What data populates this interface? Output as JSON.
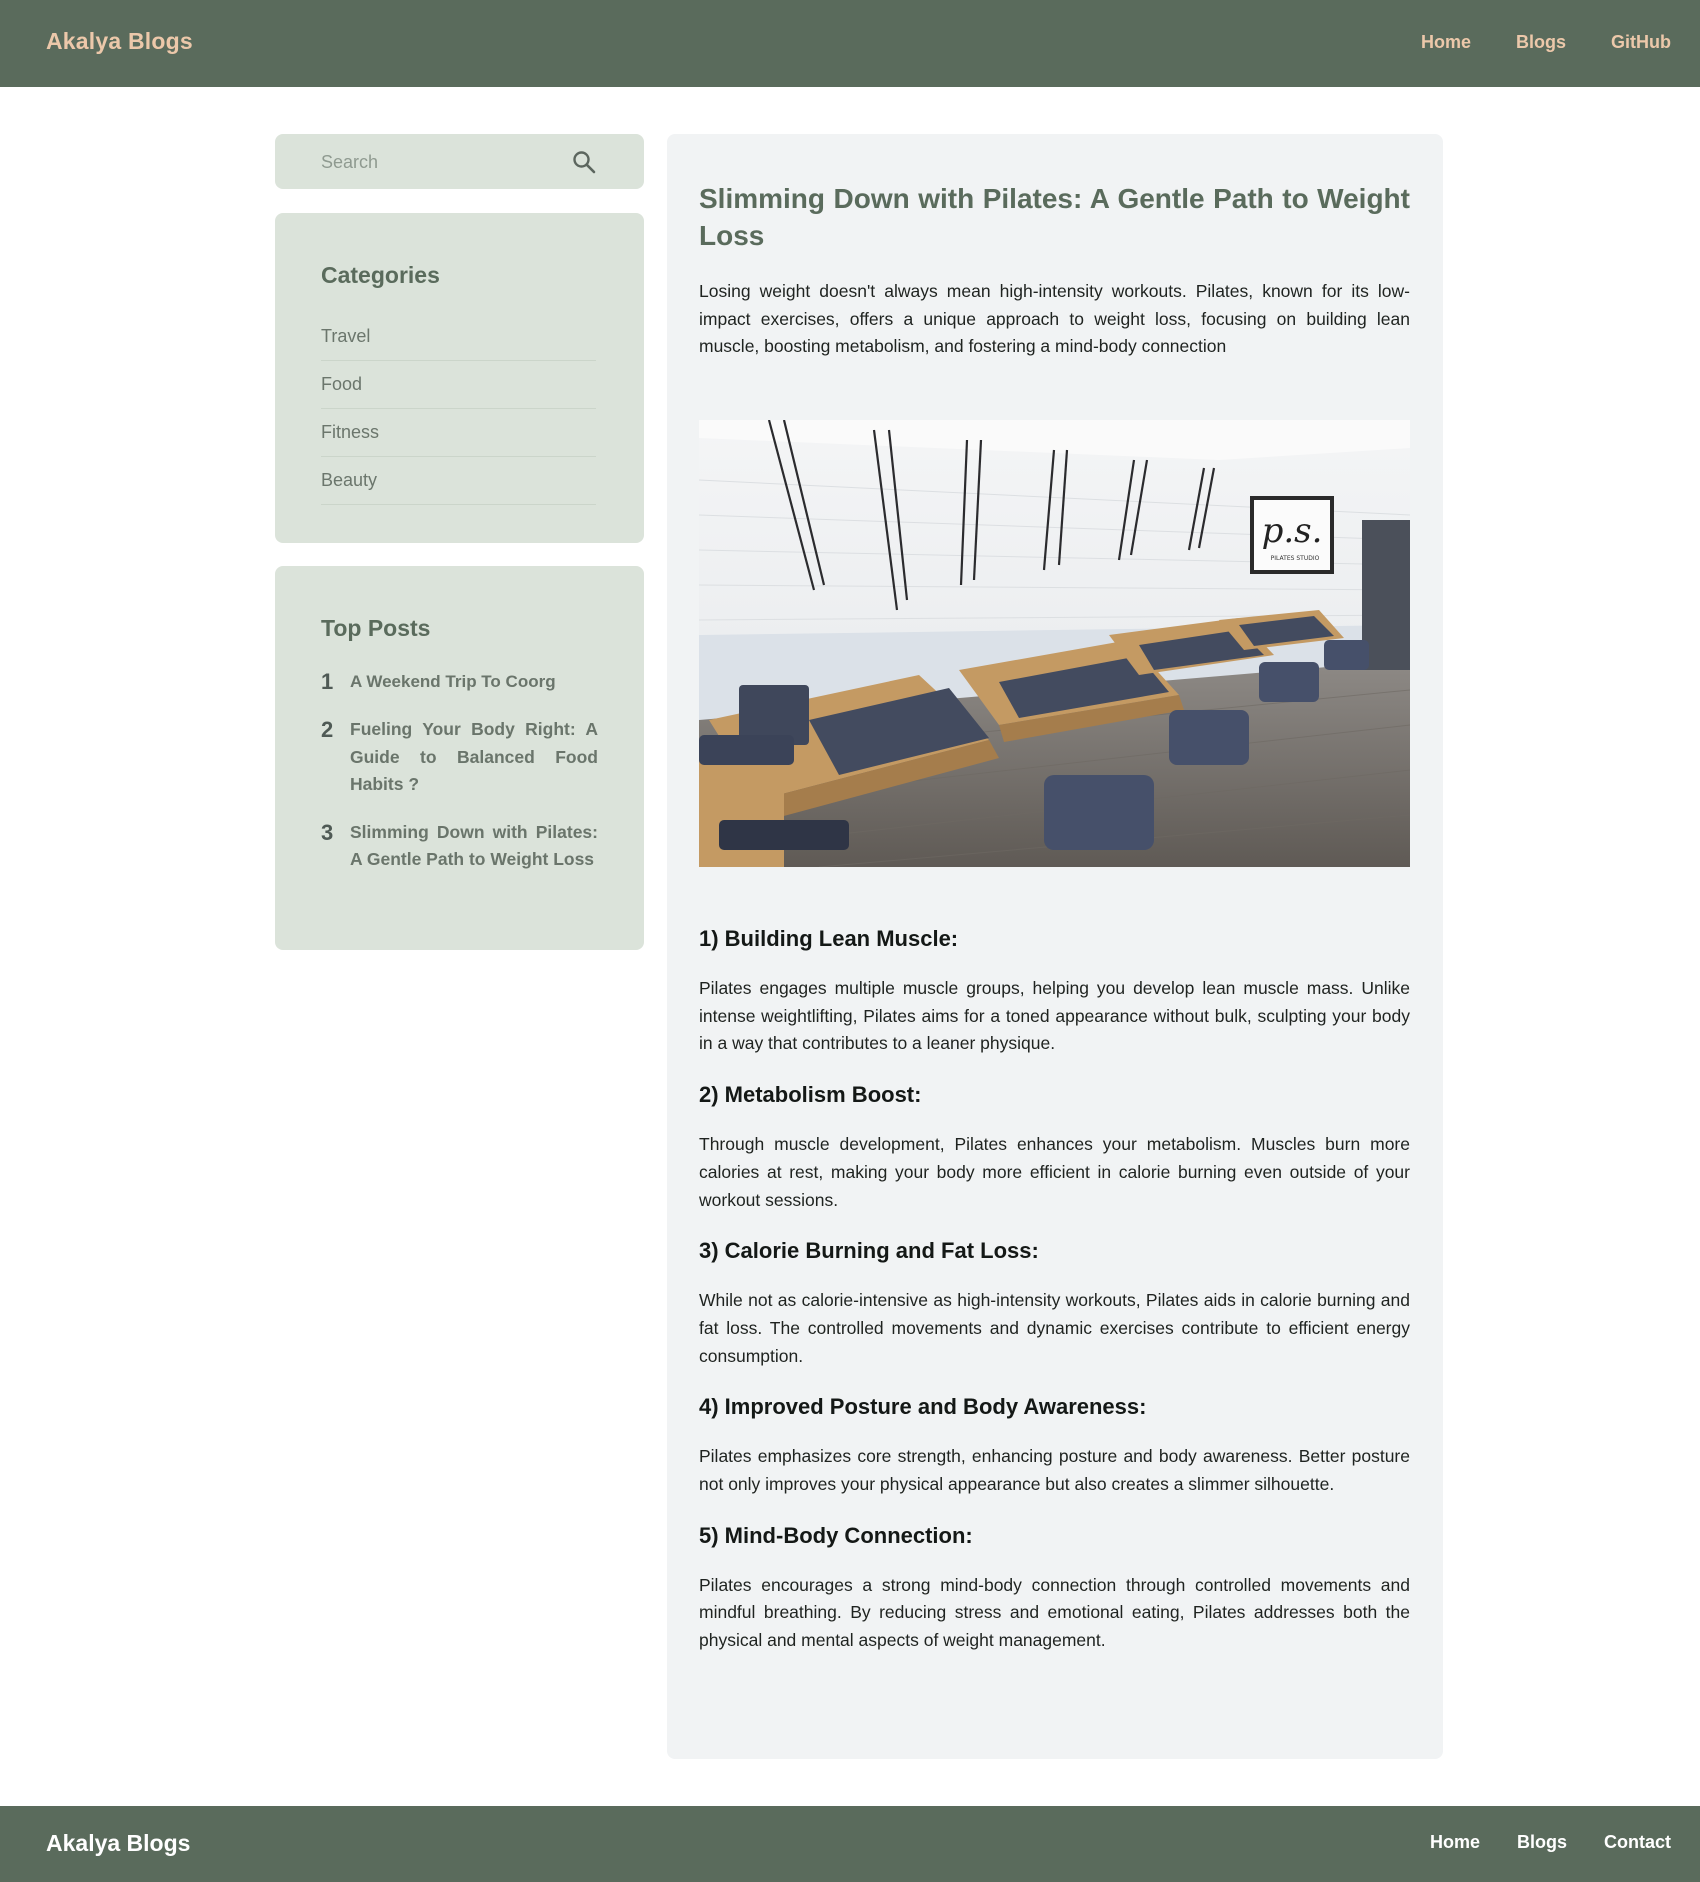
{
  "header": {
    "brand": "Akalya Blogs",
    "nav": [
      "Home",
      "Blogs",
      "GitHub"
    ]
  },
  "sidebar": {
    "search": {
      "placeholder": "Search",
      "value": ""
    },
    "categories": {
      "title": "Categories",
      "items": [
        "Travel",
        "Food",
        "Fitness",
        "Beauty"
      ]
    },
    "top_posts": {
      "title": "Top Posts",
      "items": [
        {
          "num": "1",
          "label": "A Weekend Trip To Coorg"
        },
        {
          "num": "2",
          "label": "Fueling Your Body Right: A Guide to Balanced Food Habits ?"
        },
        {
          "num": "3",
          "label": "Slimming Down with Pilates: A Gentle Path to Weight Loss"
        }
      ]
    }
  },
  "article": {
    "title": "Slimming Down with Pilates: A Gentle Path to Weight Loss",
    "intro": "Losing weight doesn't always mean high-intensity workouts. Pilates, known for its low-impact exercises, offers a unique approach to weight loss, focusing on building lean muscle, boosting metabolism, and fostering a mind-body connection",
    "image_logo_text": "p.s.",
    "image_logo_caption": "PILATES STUDIO",
    "sections": [
      {
        "heading": "1) Building Lean Muscle:",
        "text": "Pilates engages multiple muscle groups, helping you develop lean muscle mass. Unlike intense weightlifting, Pilates aims for a toned appearance without bulk, sculpting your body in a way that contributes to a leaner physique."
      },
      {
        "heading": "2) Metabolism Boost:",
        "text": "Through muscle development, Pilates enhances your metabolism. Muscles burn more calories at rest, making your body more efficient in calorie burning even outside of your workout sessions."
      },
      {
        "heading": "3) Calorie Burning and Fat Loss:",
        "text": "While not as calorie-intensive as high-intensity workouts, Pilates aids in calorie burning and fat loss. The controlled movements and dynamic exercises contribute to efficient energy consumption."
      },
      {
        "heading": "4) Improved Posture and Body Awareness:",
        "text": "Pilates emphasizes core strength, enhancing posture and body awareness. Better posture not only improves your physical appearance but also creates a slimmer silhouette."
      },
      {
        "heading": "5) Mind-Body Connection:",
        "text": "Pilates encourages a strong mind-body connection through controlled movements and mindful breathing. By reducing stress and emotional eating, Pilates addresses both the physical and mental aspects of weight management."
      }
    ]
  },
  "footer": {
    "brand": "Akalya Blogs",
    "nav": [
      "Home",
      "Blogs",
      "Contact"
    ]
  },
  "colors": {
    "header_bg": "#5a6b5c",
    "header_text": "#ecc8aa",
    "sidebar_card_bg": "#dbe3da",
    "article_bg": "#f1f3f4",
    "title_color": "#5a6b5c"
  }
}
